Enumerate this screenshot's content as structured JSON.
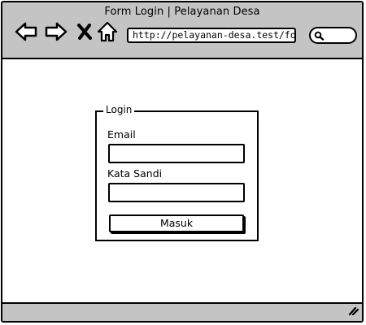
{
  "window": {
    "title": "Form Login | Pelayanan Desa"
  },
  "toolbar": {
    "back_icon": "arrow-left-icon",
    "forward_icon": "arrow-right-icon",
    "stop_icon": "close-icon",
    "home_icon": "home-icon",
    "url": "http://pelayanan-desa.test/form-",
    "search_icon": "search-icon"
  },
  "login_form": {
    "legend": "Login",
    "email_label": "Email",
    "email_value": "",
    "password_label": "Kata Sandi",
    "password_value": "",
    "submit_label": "Masuk"
  },
  "statusbar": {
    "grip_icon": "resize-grip-icon"
  }
}
